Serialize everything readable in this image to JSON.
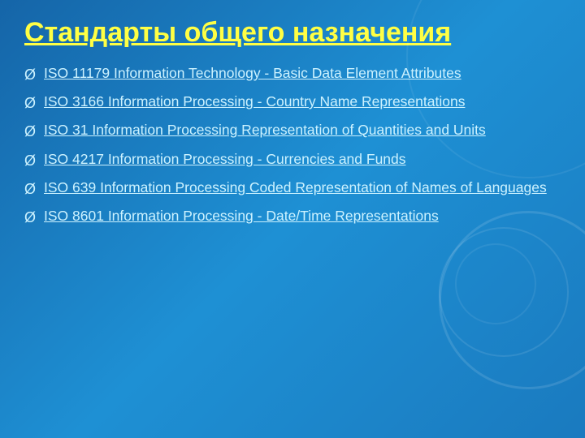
{
  "slide": {
    "title": "Стандарты общего назначения",
    "items": [
      {
        "id": 1,
        "text": "ISO 11179 Information Technology - Basic Data Element Attributes"
      },
      {
        "id": 2,
        "text": "ISO 3166 Information Processing - Country Name Representations"
      },
      {
        "id": 3,
        "text": "ISO 31 Information Processing Representation of Quantities and Units"
      },
      {
        "id": 4,
        "text": "ISO 4217 Information Processing - Currencies and Funds"
      },
      {
        "id": 5,
        "text": "ISO 639 Information Processing Coded Representation of Names of Languages"
      },
      {
        "id": 6,
        "text": "ISO 8601 Information Processing - Date/Time Representations"
      }
    ],
    "bullet_symbol": "Ø"
  }
}
